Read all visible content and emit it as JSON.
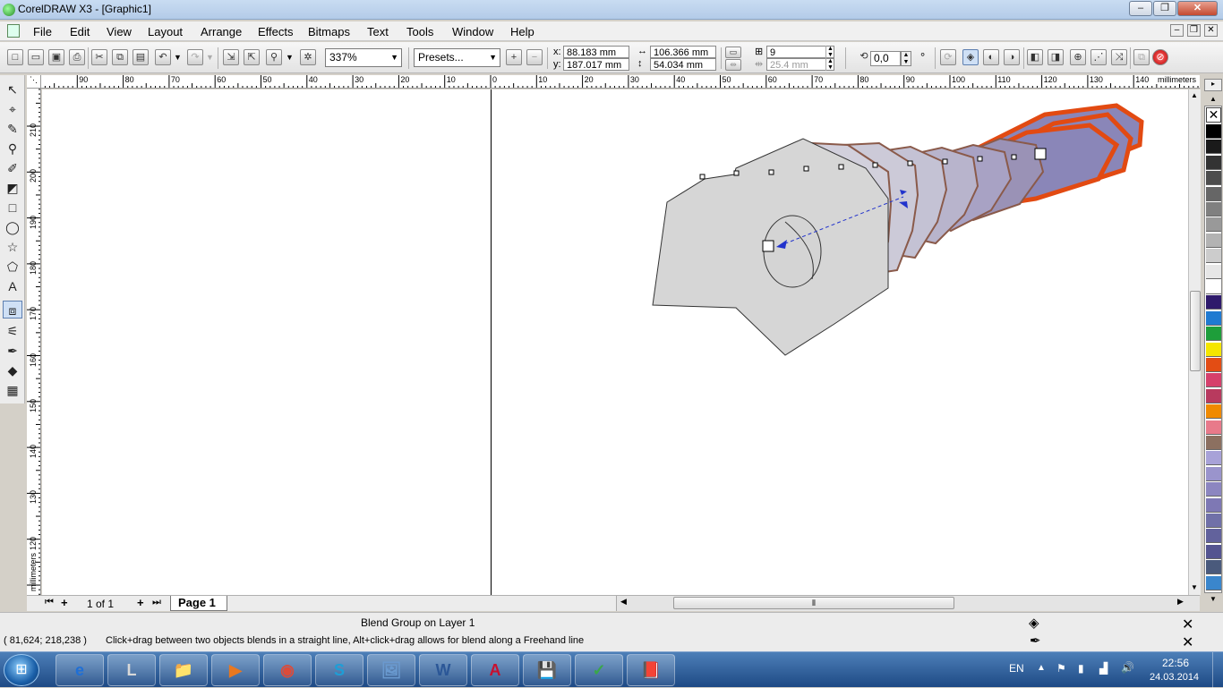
{
  "title_bar": {
    "title": "CorelDRAW X3 - [Graphic1]",
    "minimize": "–",
    "maximize": "❐",
    "close": "✕"
  },
  "menu": {
    "items": [
      "File",
      "Edit",
      "View",
      "Layout",
      "Arrange",
      "Effects",
      "Bitmaps",
      "Text",
      "Tools",
      "Window",
      "Help"
    ],
    "doc_minimize": "–",
    "doc_restore": "❐",
    "doc_close": "✕"
  },
  "toolbar": {
    "zoom_value": "337%",
    "presets_value": "Presets...",
    "x_label": "x:",
    "y_label": "y:",
    "x_value": "88.183 mm",
    "y_value": "187.017 mm",
    "width_value": "106.366 mm",
    "height_value": "54.034 mm",
    "steps_value": "9",
    "spacing_value": "25.4 mm",
    "rotation_value": "0,0",
    "degree_symbol": "°"
  },
  "rulers": {
    "units": "millimeters",
    "h_labels": [
      "90",
      "80",
      "70",
      "60",
      "50",
      "40",
      "30",
      "20",
      "10",
      "0",
      "10",
      "20",
      "30",
      "40",
      "50",
      "60",
      "70",
      "80",
      "90",
      "100",
      "110",
      "120",
      "130",
      "140"
    ],
    "v_labels": [
      "210",
      "200",
      "190",
      "180",
      "170",
      "160",
      "150",
      "140",
      "130",
      "120"
    ],
    "v_units": "millimeters"
  },
  "page_nav": {
    "page_count": "1 of 1",
    "page_tab": "Page 1"
  },
  "status": {
    "object_info": "Blend Group on Layer 1",
    "coordinates": "( 81,624; 218,238 )",
    "hint": "Click+drag between two objects blends in a straight line, Alt+click+drag allows for blend along a Freehand line"
  },
  "palette": {
    "colors": [
      "#000000",
      "#1a1a1a",
      "#333333",
      "#4d4d4d",
      "#666666",
      "#808080",
      "#999999",
      "#b3b3b3",
      "#cccccc",
      "#e6e6e6",
      "#ffffff",
      "#2e1a6b",
      "#1f7ad1",
      "#1e9e3a",
      "#f5e600",
      "#e34d14",
      "#d6406b",
      "#b83a5e",
      "#f08a00",
      "#e87a8a",
      "#8c7060",
      "#a8a2d8",
      "#9a94cc",
      "#8c86c0",
      "#7e78b4",
      "#7070a8",
      "#62629c",
      "#545490",
      "#4a5a7c",
      "#3a86cc"
    ]
  },
  "taskbar": {
    "apps": [
      "e",
      "L",
      "📁",
      "▶",
      "◉",
      "S",
      "🖼",
      "W",
      "A",
      "💾",
      "✓",
      "📕"
    ],
    "language": "EN",
    "time": "22:56",
    "date": "24.03.2014"
  }
}
